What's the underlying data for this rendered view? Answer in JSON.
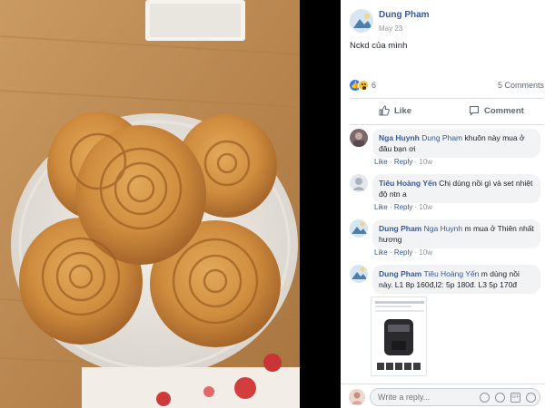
{
  "post": {
    "author": "Dung Pham",
    "date": "May 23",
    "text": "Nckd của mình",
    "reactions_count": "6",
    "comments_count": "5 Comments",
    "reactions": [
      "like-icon",
      "wow-icon"
    ]
  },
  "actions": {
    "like_label": "Like",
    "comment_label": "Comment"
  },
  "comments": [
    {
      "name": "Nga Huynh",
      "tag": "Dung Pham",
      "text": "khuôn này mua ở đâu bạn ơi",
      "like": "Like",
      "reply": "Reply",
      "ago": "10w"
    },
    {
      "name": "Tiêu Hoàng Yến",
      "tag": "",
      "text": "Chị dùng nồi gì và set nhiệt độ ntn a",
      "like": "Like",
      "reply": "Reply",
      "ago": "10w"
    },
    {
      "name": "Dung Pham",
      "tag": "Nga Huynh",
      "text": "m mua ở Thiên nhất hương",
      "like": "Like",
      "reply": "Reply",
      "ago": "10w"
    },
    {
      "name": "Dung Pham",
      "tag": "Tiêu Hoàng Yến",
      "text": "m dùng nồi này. L1 8p 160đ,l2: 5p 180đ. L3 5p 170đ"
    }
  ],
  "reply": {
    "placeholder": "Write a reply..."
  },
  "colors": {
    "link_blue": "#385898",
    "bubble_bg": "#f2f3f5",
    "like_blue": "#2b79f4"
  }
}
